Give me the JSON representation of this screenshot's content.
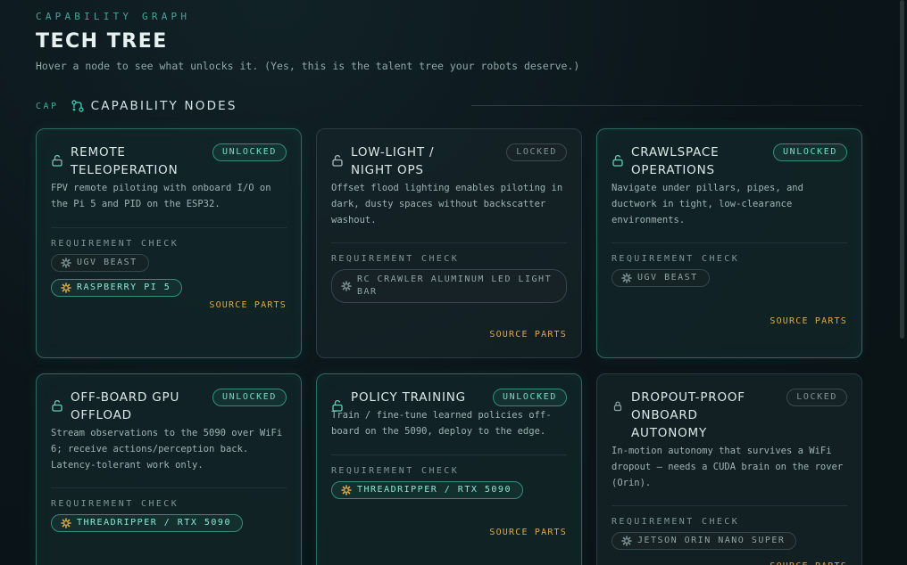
{
  "header": {
    "kicker": "CAPABILITY GRAPH",
    "title": "TECH TREE",
    "subtitle": "Hover a node to see what unlocks it. (Yes, this is the talent tree your robots deserve.)"
  },
  "section": {
    "tag": "CAP",
    "icon": "node-graph-icon",
    "label": "CAPABILITY NODES"
  },
  "common": {
    "requirement_label": "REQUIREMENT CHECK",
    "source_label": "SOURCE PARTS"
  },
  "colors": {
    "accent_teal": "#6fdcc4",
    "source_amber": "#e0a94a",
    "background": "#0b1519"
  },
  "cards": [
    {
      "title": "REMOTE TELEOPERATION",
      "status": "UNLOCKED",
      "lock_icon": "unlocked-padlock-icon",
      "description": "FPV remote piloting with onboard I/O on the Pi 5 and PID on the ESP32.",
      "requirements": [
        {
          "label": "UGV BEAST",
          "have": false
        },
        {
          "label": "RASPBERRY PI 5",
          "have": true
        }
      ]
    },
    {
      "title": "LOW-LIGHT / NIGHT OPS",
      "status": "LOCKED",
      "lock_icon": "unlocked-padlock-icon",
      "description": "Offset flood lighting enables piloting in dark, dusty spaces without backscatter washout.",
      "requirements": [
        {
          "label": "RC CRAWLER ALUMINUM LED LIGHT BAR",
          "have": false
        }
      ]
    },
    {
      "title": "CRAWLSPACE OPERATIONS",
      "status": "UNLOCKED",
      "lock_icon": "unlocked-padlock-icon",
      "description": "Navigate under pillars, pipes, and ductwork in tight, low-clearance environments.",
      "requirements": [
        {
          "label": "UGV BEAST",
          "have": false
        }
      ]
    },
    {
      "title": "OFF-BOARD GPU OFFLOAD",
      "status": "UNLOCKED",
      "lock_icon": "unlocked-padlock-icon",
      "description": "Stream observations to the 5090 over WiFi 6; receive actions/perception back. Latency-tolerant work only.",
      "requirements": [
        {
          "label": "THREADRIPPER / RTX 5090",
          "have": true
        }
      ]
    },
    {
      "title": "POLICY TRAINING",
      "status": "UNLOCKED",
      "lock_icon": "unlocked-padlock-icon",
      "description": "Train / fine-tune learned policies off-board on the 5090, deploy to the edge.",
      "requirements": [
        {
          "label": "THREADRIPPER / RTX 5090",
          "have": true
        }
      ]
    },
    {
      "title": "DROPOUT-PROOF ONBOARD AUTONOMY",
      "status": "LOCKED",
      "lock_icon": "locked-padlock-icon",
      "description": "In-motion autonomy that survives a WiFi dropout — needs a CUDA brain on the rover (Orin).",
      "requirements": [
        {
          "label": "JETSON ORIN NANO SUPER",
          "have": false
        }
      ]
    }
  ]
}
